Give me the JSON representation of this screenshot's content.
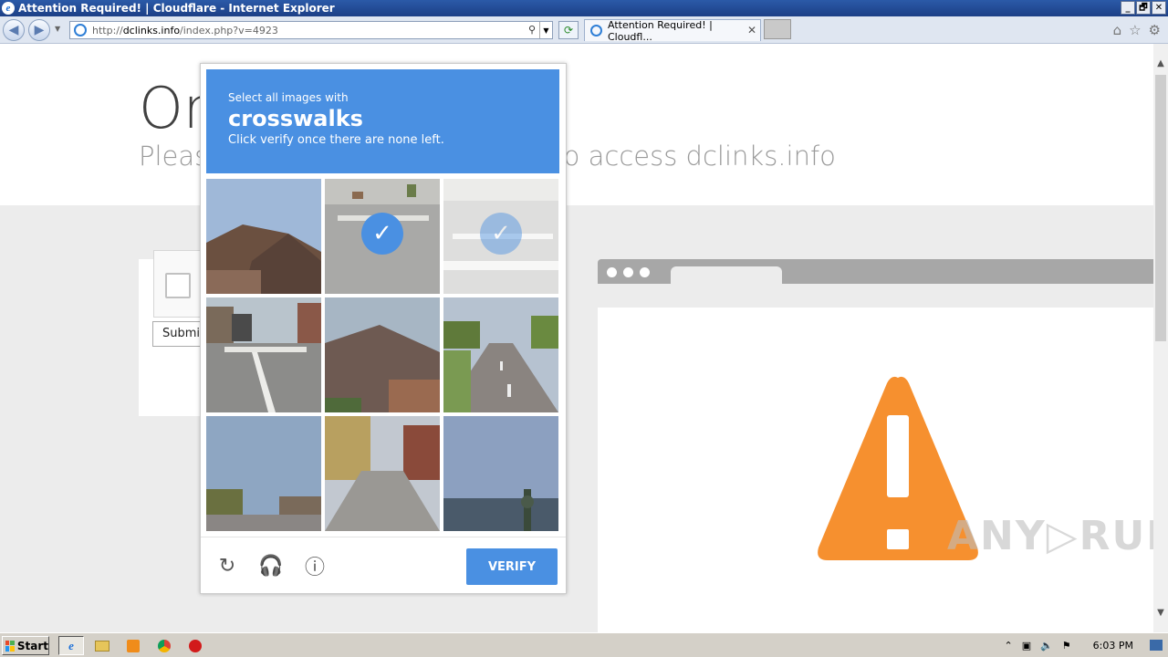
{
  "window": {
    "title": "Attention Required! | Cloudflare - Internet Explorer",
    "buttons": [
      "_",
      "🗗",
      "✕"
    ]
  },
  "navbar": {
    "url_prefix": "http://",
    "url_domain": "dclinks.info",
    "url_path": "/index.php?v=4923",
    "tab_title": "Attention Required! | Cloudfl...",
    "tab_close": "✕"
  },
  "page": {
    "heading_visible": "Or",
    "subtitle_left": "Pleas",
    "subtitle_right": "to access dclinks.info",
    "submit_label": "Submit"
  },
  "captcha": {
    "prompt_line1": "Select all images with",
    "prompt_target": "crosswalks",
    "prompt_line3": "Click verify once there are none left.",
    "verify_label": "VERIFY",
    "tiles": [
      {
        "scene": "rooftop",
        "state": "normal"
      },
      {
        "scene": "street-crosswalk",
        "state": "selected"
      },
      {
        "scene": "street-crosswalk",
        "state": "selected-fading"
      },
      {
        "scene": "city-crosswalk",
        "state": "normal"
      },
      {
        "scene": "rooftop",
        "state": "normal"
      },
      {
        "scene": "road",
        "state": "normal"
      },
      {
        "scene": "palm-street",
        "state": "normal"
      },
      {
        "scene": "residential-street",
        "state": "normal"
      },
      {
        "scene": "waterfront",
        "state": "normal"
      }
    ]
  },
  "watermark": "ANY▷RUN",
  "taskbar": {
    "start_label": "Start",
    "clock": "6:03 PM"
  },
  "colors": {
    "captcha_blue": "#4a90e2",
    "warning_orange": "#f6902f"
  }
}
